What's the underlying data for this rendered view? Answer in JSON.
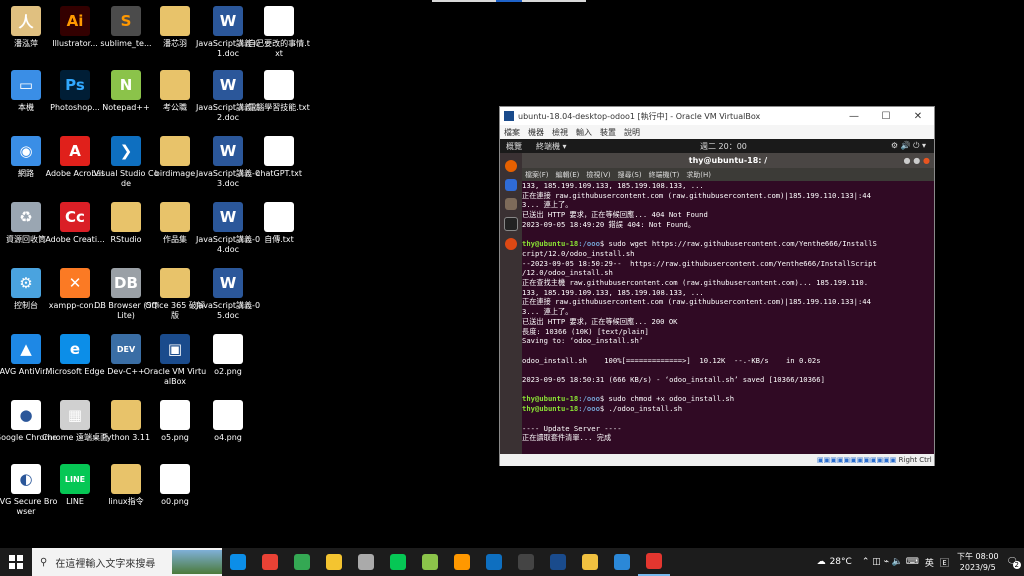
{
  "desktop_icons": [
    {
      "label": "潘泓萍",
      "color": "#e0c080",
      "glyph": "人"
    },
    {
      "label": "Illustrator...",
      "color": "#330000",
      "glyph": "Ai",
      "fg": "#ff9a00"
    },
    {
      "label": "sublime_te...",
      "color": "#4b4b4b",
      "glyph": "S",
      "fg": "#ff9800"
    },
    {
      "label": "潘芯羽",
      "color": "#e8c36a",
      "glyph": ""
    },
    {
      "label": "JavaScript講義-01.doc",
      "color": "#2b579a",
      "glyph": "W"
    },
    {
      "label": "自己要改的事情.txt",
      "color": "#ffffff",
      "glyph": ""
    },
    {
      "label": "本機",
      "color": "#3a8ee6",
      "glyph": "▭"
    },
    {
      "label": "Photoshop...",
      "color": "#001e36",
      "glyph": "Ps",
      "fg": "#31a8ff"
    },
    {
      "label": "Notepad++",
      "color": "#8bc34a",
      "glyph": "N"
    },
    {
      "label": "考公職",
      "color": "#e8c36a",
      "glyph": ""
    },
    {
      "label": "JavaScript講義-02.doc",
      "color": "#2b579a",
      "glyph": "W"
    },
    {
      "label": "電腦學習技能.txt",
      "color": "#ffffff",
      "glyph": ""
    },
    {
      "label": "網路",
      "color": "#3a8ee6",
      "glyph": "◉"
    },
    {
      "label": "Adobe Acrobat",
      "color": "#e0201b",
      "glyph": "A"
    },
    {
      "label": "Visual Studio Code",
      "color": "#0e6fc0",
      "glyph": "❯"
    },
    {
      "label": "birdimage",
      "color": "#e8c36a",
      "glyph": ""
    },
    {
      "label": "JavaScript講義-03.doc",
      "color": "#2b579a",
      "glyph": "W"
    },
    {
      "label": "chatGPT.txt",
      "color": "#ffffff",
      "glyph": ""
    },
    {
      "label": "資源回收筒",
      "color": "#9aa6b2",
      "glyph": "♻"
    },
    {
      "label": "Adobe Creati...",
      "color": "#da1f26",
      "glyph": "Cc"
    },
    {
      "label": "RStudio",
      "color": "#e8c36a",
      "glyph": ""
    },
    {
      "label": "作品集",
      "color": "#e8c36a",
      "glyph": ""
    },
    {
      "label": "JavaScript講義-04.doc",
      "color": "#2b579a",
      "glyph": "W"
    },
    {
      "label": "自傳.txt",
      "color": "#ffffff",
      "glyph": ""
    },
    {
      "label": "控制台",
      "color": "#4aa3df",
      "glyph": "⚙"
    },
    {
      "label": "xampp-con...",
      "color": "#fb7a24",
      "glyph": "✕"
    },
    {
      "label": "DB Browser (SQLite)",
      "color": "#9aa0a6",
      "glyph": "DB"
    },
    {
      "label": "Office 365 破解版",
      "color": "#e8c36a",
      "glyph": ""
    },
    {
      "label": "JavaScript講義-05.doc",
      "color": "#2b579a",
      "glyph": "W"
    },
    {
      "label": "AVG AntiVir...",
      "color": "#1e88e5",
      "glyph": "▲"
    },
    {
      "label": "Microsoft Edge",
      "color": "#0c8ee8",
      "glyph": "e"
    },
    {
      "label": "Dev-C++",
      "color": "#3a6ea5",
      "glyph": "DEV"
    },
    {
      "label": "Oracle VM VirtualBox",
      "color": "#1a4b8c",
      "glyph": "▣"
    },
    {
      "label": "o2.png",
      "color": "#ffffff",
      "glyph": ""
    },
    {
      "label": "Google Chrome",
      "color": "#ffffff",
      "glyph": "●"
    },
    {
      "label": "Chrome 遠端桌面",
      "color": "#d0d0d0",
      "glyph": "▦"
    },
    {
      "label": "Python 3.11",
      "color": "#e8c36a",
      "glyph": ""
    },
    {
      "label": "o5.png",
      "color": "#ffffff",
      "glyph": ""
    },
    {
      "label": "o4.png",
      "color": "#ffffff",
      "glyph": ""
    },
    {
      "label": "AVG Secure Browser",
      "color": "#ffffff",
      "glyph": "◐"
    },
    {
      "label": "LINE",
      "color": "#06c755",
      "glyph": "LINE"
    },
    {
      "label": "linux指令",
      "color": "#e8c36a",
      "glyph": ""
    },
    {
      "label": "o0.png",
      "color": "#ffffff",
      "glyph": ""
    }
  ],
  "vbox": {
    "title": "ubuntu-18.04-desktop-odoo1 [執行中] - Oracle VM VirtualBox",
    "menu": [
      "檔案",
      "機器",
      "檢視",
      "輸入",
      "裝置",
      "說明"
    ],
    "status_text": "Right Ctrl"
  },
  "guest": {
    "activities": "概覽",
    "app_menu": "終端機 ▾",
    "clock": "週二 20：00",
    "term_title": "thy@ubuntu-18: /",
    "term_menu": [
      "檔案(F)",
      "編輯(E)",
      "檢視(V)",
      "搜尋(S)",
      "終端機(T)",
      "求助(H)"
    ],
    "lines": [
      {
        "t": "133, 185.199.109.133, 185.199.108.133, ..."
      },
      {
        "t": "正在連接 raw.githubusercontent.com (raw.githubusercontent.com)|185.199.110.133|:44"
      },
      {
        "t": "3... 連上了。"
      },
      {
        "t": "已送出 HTTP 要求，正在等候回應... 404 Not Found"
      },
      {
        "t": "2023-09-05 18:49:20 錯誤 404: Not Found。"
      },
      {
        "t": ""
      },
      {
        "p": "thy@ubuntu-18",
        "d": ":/ooo",
        "t": "$ sudo wget https://raw.githubusercontent.com/Yenthe666/InstallS"
      },
      {
        "t": "cript/12.0/odoo_install.sh"
      },
      {
        "t": "--2023-09-05 18:50:29--  https://raw.githubusercontent.com/Yenthe666/InstallScript"
      },
      {
        "t": "/12.0/odoo_install.sh"
      },
      {
        "t": "正在查找主機 raw.githubusercontent.com (raw.githubusercontent.com)... 185.199.110."
      },
      {
        "t": "133, 185.199.109.133, 185.199.108.133, ..."
      },
      {
        "t": "正在連接 raw.githubusercontent.com (raw.githubusercontent.com)|185.199.110.133|:44"
      },
      {
        "t": "3... 連上了。"
      },
      {
        "t": "已送出 HTTP 要求，正在等候回應... 200 OK"
      },
      {
        "t": "長度: 10366 (10K) [text/plain]"
      },
      {
        "t": "Saving to: ‘odoo_install.sh’"
      },
      {
        "t": ""
      },
      {
        "t": "odoo_install.sh    100%[=============>]  10.12K  --.-KB/s    in 0.02s"
      },
      {
        "t": ""
      },
      {
        "t": "2023-09-05 18:50:31 (666 KB/s) - ‘odoo_install.sh’ saved [10366/10366]"
      },
      {
        "t": ""
      },
      {
        "p": "thy@ubuntu-18",
        "d": ":/ooo",
        "t": "$ sudo chmod +x odoo_install.sh"
      },
      {
        "p": "thy@ubuntu-18",
        "d": ":/ooo",
        "t": "$ ./odoo_install.sh"
      },
      {
        "t": ""
      },
      {
        "t": "---- Update Server ----"
      },
      {
        "t": "正在讀取套件清單... 完成"
      }
    ]
  },
  "taskbar": {
    "search_placeholder": "在這裡輸入文字來搜尋",
    "apps": [
      {
        "name": "edge",
        "color": "#0c8ee8"
      },
      {
        "name": "chrome",
        "color": "#e94235"
      },
      {
        "name": "chrome-profile",
        "color": "#34a853"
      },
      {
        "name": "explorer",
        "color": "#f4c430"
      },
      {
        "name": "pinwheel",
        "color": "#aaaaaa"
      },
      {
        "name": "line",
        "color": "#06c755"
      },
      {
        "name": "notepadpp",
        "color": "#8bc34a"
      },
      {
        "name": "sublime",
        "color": "#ff9800"
      },
      {
        "name": "vscode",
        "color": "#0e6fc0"
      },
      {
        "name": "terminal",
        "color": "#444444"
      },
      {
        "name": "virtualbox",
        "color": "#1a4b8c"
      },
      {
        "name": "tool",
        "color": "#f0c040"
      },
      {
        "name": "photos",
        "color": "#2b88d8"
      },
      {
        "name": "snip",
        "color": "#e3362f"
      }
    ],
    "weather": "28°C",
    "ime": "英",
    "time": "下午 08:00",
    "date": "2023/9/5",
    "notifications": "2"
  }
}
